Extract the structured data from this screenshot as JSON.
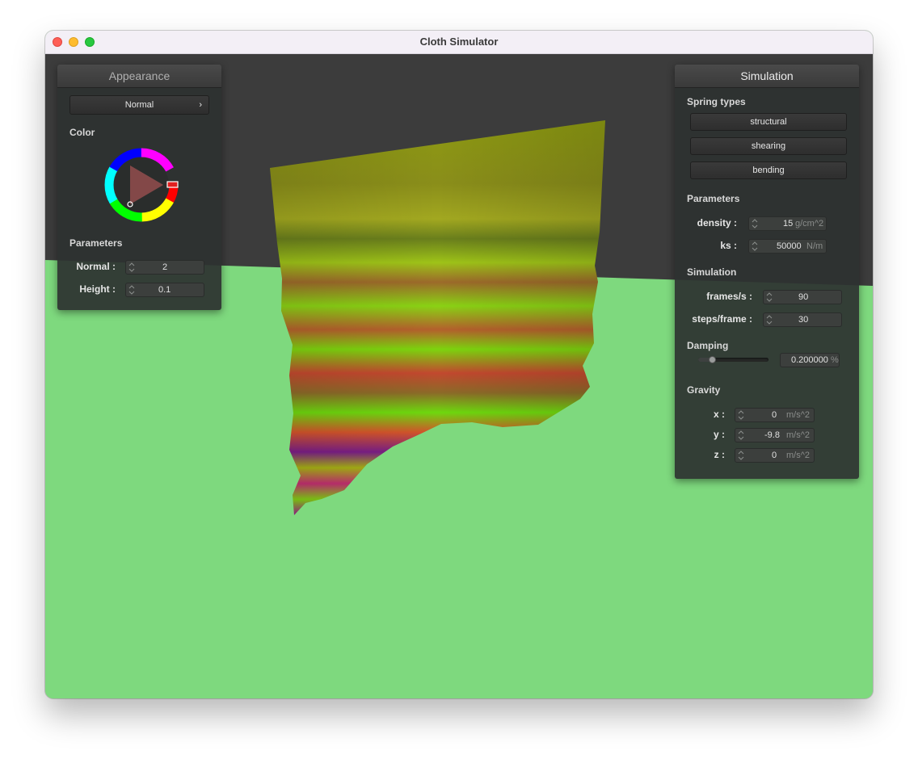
{
  "window": {
    "title": "Cloth Simulator"
  },
  "appearance": {
    "title": "Appearance",
    "shader_selected": "Normal",
    "chevron": "›",
    "color_label": "Color",
    "parameters_label": "Parameters",
    "normal_label": "Normal :",
    "normal_value": "2",
    "height_label": "Height :",
    "height_value": "0.1"
  },
  "simulation": {
    "title": "Simulation",
    "spring_types_label": "Spring types",
    "spring_buttons": [
      "structural",
      "shearing",
      "bending"
    ],
    "parameters_label": "Parameters",
    "density_label": "density :",
    "density_value": "15",
    "density_unit": "g/cm^2",
    "ks_label": "ks :",
    "ks_value": "50000",
    "ks_unit": "N/m",
    "simulation_label": "Simulation",
    "fps_label": "frames/s :",
    "fps_value": "90",
    "steps_label": "steps/frame :",
    "steps_value": "30",
    "damping_label": "Damping",
    "damping_fraction": 0.2,
    "damping_value": "0.200000",
    "damping_unit": "%",
    "gravity_label": "Gravity",
    "gx_label": "x :",
    "gx_value": "0",
    "gy_label": "y :",
    "gy_value": "-9.8",
    "gz_label": "z :",
    "gz_value": "0",
    "gravity_unit": "m/s^2"
  },
  "colors": {
    "floor": "#7ed97e",
    "sky": "#3c3c3c",
    "panel_bg": "#2d3230",
    "accent_red": "#e02020"
  }
}
